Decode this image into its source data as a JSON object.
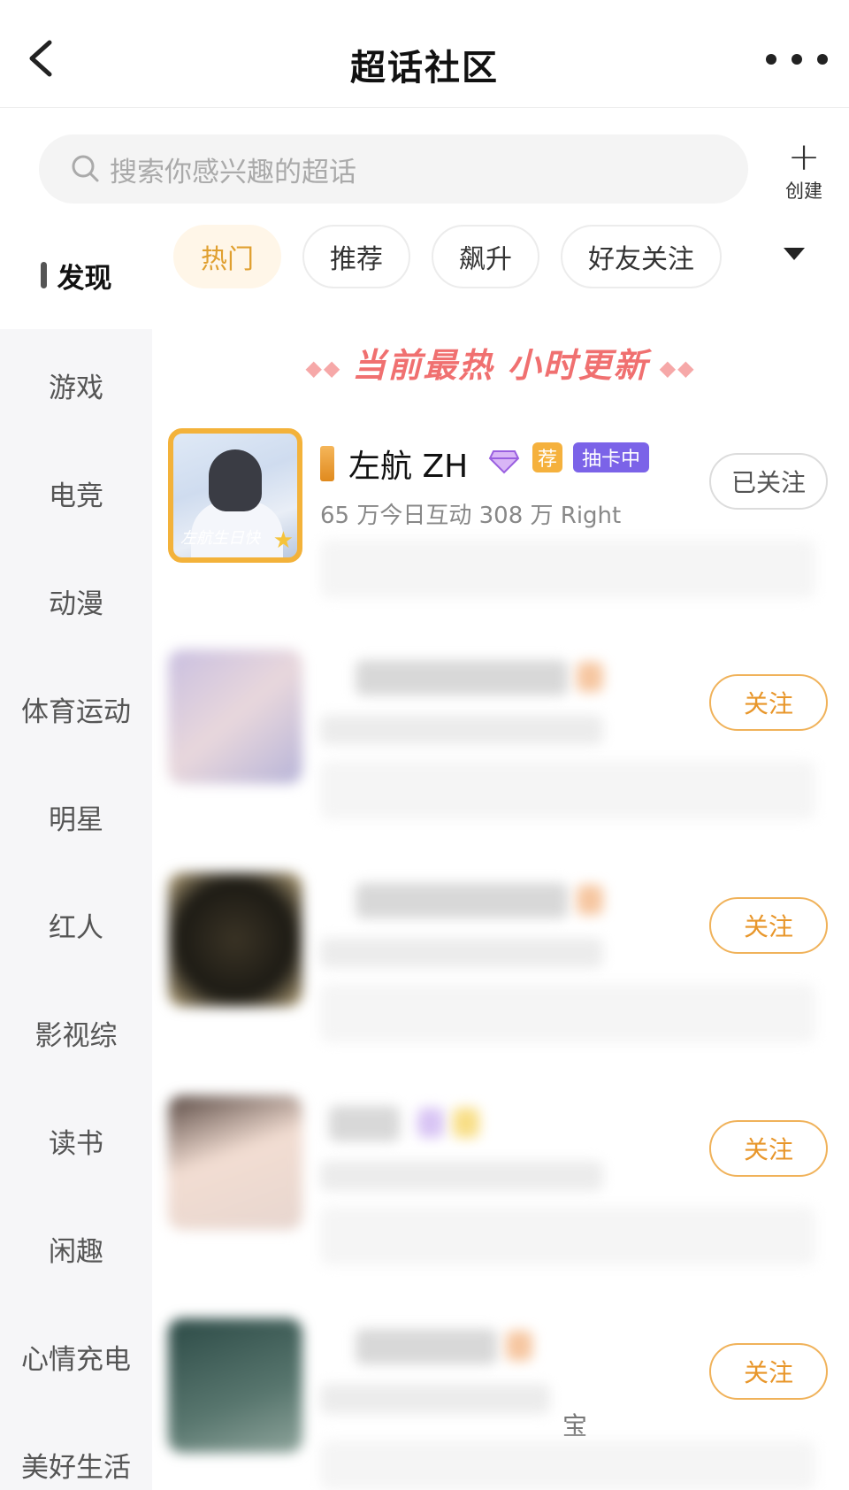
{
  "header": {
    "title": "超话社区"
  },
  "search": {
    "placeholder": "搜索你感兴趣的超话",
    "create_label": "创建"
  },
  "sidebar": {
    "items": [
      {
        "label": "发现",
        "active": true
      },
      {
        "label": "游戏"
      },
      {
        "label": "电竞"
      },
      {
        "label": "动漫"
      },
      {
        "label": "体育运动"
      },
      {
        "label": "明星"
      },
      {
        "label": "红人"
      },
      {
        "label": "影视综"
      },
      {
        "label": "读书"
      },
      {
        "label": "闲趣"
      },
      {
        "label": "心情充电"
      },
      {
        "label": "美好生活"
      }
    ]
  },
  "chips": [
    {
      "label": "热门",
      "active": true
    },
    {
      "label": "推荐"
    },
    {
      "label": "飙升"
    },
    {
      "label": "好友关注"
    }
  ],
  "banner": {
    "text": "当前最热  小时更新"
  },
  "list": [
    {
      "name": "左航 ZH",
      "tag_recommend": "荐",
      "tag_draw": "抽卡中",
      "stats": "65 万今日互动  308 万 Right",
      "button": "已关注",
      "avatar_text": "左航生日快",
      "followed": true
    },
    {
      "button": "关注"
    },
    {
      "button": "关注"
    },
    {
      "button": "关注"
    },
    {
      "button": "关注",
      "partial_text": "宝"
    }
  ],
  "colors": {
    "accent_orange": "#e8962a",
    "draw_tag_purple": "#7b63e8",
    "banner_red": "#f07070",
    "chip_active_bg": "#fff6e8"
  },
  "icons": [
    "back-arrow-icon",
    "more-dots-icon",
    "search-icon",
    "plus-icon",
    "dropdown-caret-icon",
    "gem-icon"
  ]
}
